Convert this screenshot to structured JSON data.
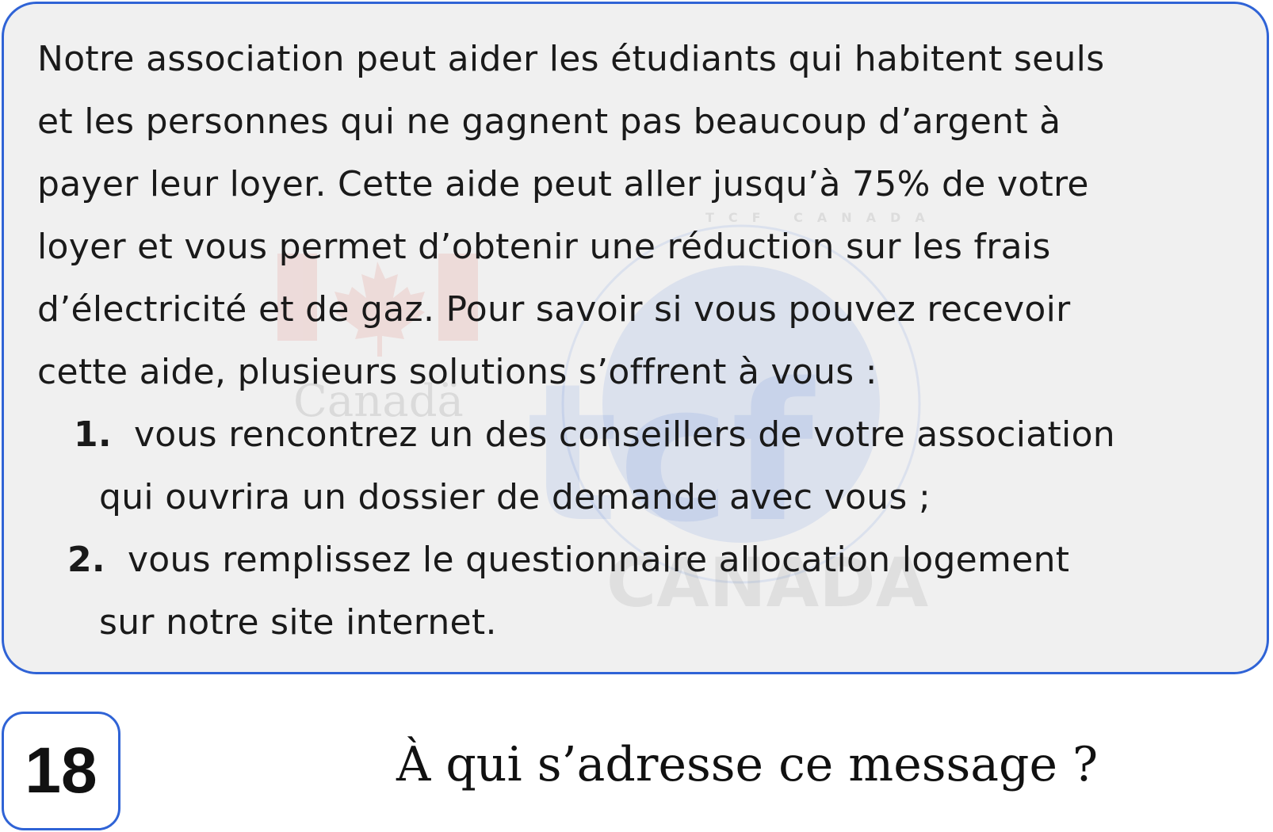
{
  "passage": {
    "lines": [
      "Notre association peut aider les étudiants qui habitent seuls",
      "et les personnes qui ne gagnent pas beaucoup d’argent à",
      "payer leur loyer. Cette aide peut aller jusqu’à 75% de votre",
      "loyer et vous permet d’obtenir une réduction sur les frais",
      "d’électricité et de gaz. Pour savoir si vous pouvez recevoir",
      "cette aide, plusieurs solutions s’offrent à vous :"
    ]
  },
  "options": [
    {
      "number": "1.",
      "line1": "vous rencontrez un des conseillers de votre association",
      "line2": "qui ouvrira un dossier de demande avec vous ;"
    },
    {
      "number": "2.",
      "line1": "vous remplissez le questionnaire allocation logement",
      "line2": "sur notre site internet."
    }
  ],
  "watermark": {
    "left_word": "Canadä",
    "brand": "tcf",
    "country": "CANADA",
    "ring_text": "TCF CANADA"
  },
  "question": {
    "number": "18",
    "text": "À qui s’adresse ce message ?"
  },
  "colors": {
    "border": "#2f63d6",
    "card_background": "#f0f0f0",
    "text": "#1a1a1a"
  }
}
